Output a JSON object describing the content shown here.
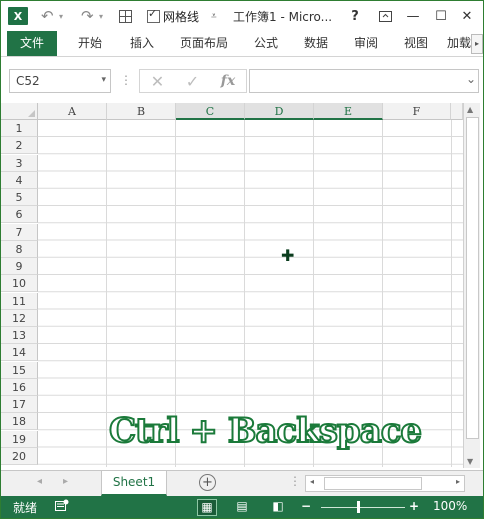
{
  "titlebar": {
    "app_icon": "X",
    "undo_icon": "undo-icon",
    "redo_icon": "redo-icon",
    "borders_icon": "grid-border-icon",
    "gridlines_label": "网格线",
    "title": "工作簿1 - Micro...",
    "help": "?",
    "ribbon_display_icon": "ribbon-display-icon",
    "minimize": "—",
    "maximize": "☐",
    "close": "✕"
  },
  "ribbon": {
    "tabs": [
      "文件",
      "开始",
      "插入",
      "页面布局",
      "公式",
      "数据",
      "审阅",
      "视图",
      "加载"
    ],
    "active_tab": "文件"
  },
  "formula_bar": {
    "name_box_value": "C52",
    "cancel_icon": "✕",
    "enter_icon": "✓",
    "fx_label": "fx",
    "formula_value": ""
  },
  "grid": {
    "columns": [
      "A",
      "B",
      "C",
      "D",
      "E",
      "F"
    ],
    "selected_columns": [
      "C",
      "D",
      "E"
    ],
    "rows": [
      "1",
      "2",
      "3",
      "4",
      "5",
      "6",
      "7",
      "8",
      "9",
      "10",
      "11",
      "12",
      "13",
      "14",
      "15",
      "16",
      "17",
      "18",
      "19",
      "20"
    ]
  },
  "overlay_caption": "Ctrl + Backspace",
  "sheets": {
    "tabs": [
      "Sheet1"
    ],
    "active": "Sheet1",
    "add_icon": "+"
  },
  "status": {
    "ready_text": "就绪",
    "macro_icon": "macro-record-icon",
    "zoom_out": "−",
    "zoom_in": "+",
    "zoom_level": "100%",
    "zoom_fraction": 0.5
  },
  "colors": {
    "accent": "#217346",
    "header_bg": "#f2f2f2",
    "gridline": "#dadada"
  }
}
